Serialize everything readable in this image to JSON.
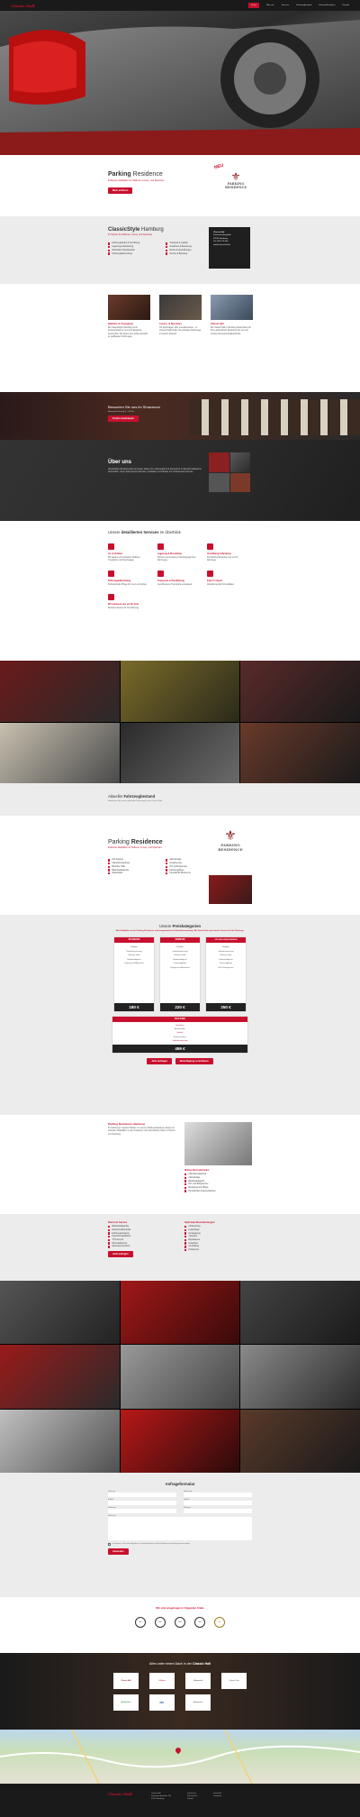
{
  "header": {
    "logo_text": "Classic Hall",
    "nav": [
      "Home",
      "Über uns",
      "Services",
      "Fahrzeugbestand",
      "Parking Residence",
      "Kontakt"
    ]
  },
  "residence_banner": {
    "title_bold": "Parking",
    "title_rest": " Residence",
    "subtitle": "Exklusive Stellplätze für Oldtimer, Luxury- und Sportcars",
    "button": "Mehr erfahren",
    "new_badge": "NEU",
    "logo_line1": "PARKING",
    "logo_line2": "RESIDENCE"
  },
  "classicstyle": {
    "title_bold": "ClassicStyle",
    "title_rest": " Hamburg",
    "subtitle": "Ihr Partner für Oldtimer, Luxury- und Sportcars",
    "bullets_left": [
      "Fahrzeughandel & Vermittlung",
      "Lagerung & Einstellung",
      "Werkstatt & Restauration",
      "Fahrzeugaufbereitung"
    ],
    "bullets_right": [
      "Transport & Logistik",
      "Gutachten & Bewertung",
      "Events & Ausstellungen",
      "Service & Beratung"
    ],
    "contact_box": [
      "Classic Hall",
      "Schnackenburgallee",
      "22525 Hamburg",
      "Tel: 040 123 456",
      "info@classichall.de"
    ]
  },
  "three_cols": [
    {
      "title": "Oldtimer & Youngtimer",
      "text": "Die ClassicStyle Hamburg ist Ihr Ansprechpartner rund um klassische Automobile. Wir bieten eine große Auswahl an gepflegten Fahrzeugen."
    },
    {
      "title": "Luxury- & Sportcars",
      "text": "Ob Sportwagen oder Luxuslimousine – in unserer Halle finden Sie exklusive Fahrzeuge in bestem Zustand."
    },
    {
      "title": "Classic Hall",
      "text": "Die Classic Hall in Hamburg bietet Raum für Ihre Leidenschaft. Besuchen Sie uns und erleben Sie Automobilgeschichte."
    }
  ],
  "visit": {
    "title": "Besuchen Sie uns im Showroom",
    "sub": "Montag bis Freitag 9 – 18 Uhr",
    "button": "Termin vereinbaren"
  },
  "about": {
    "title": "Über uns",
    "text": "ClassicStyle Hamburg steht seit vielen Jahren für Leidenschaft und Kompetenz im Bereich klassischer Automobile. Unser Team betreut Sammler, Liebhaber und Händler mit umfassendem Service."
  },
  "services": {
    "title_pre": "Unsere ",
    "title_bold": "detaillierten Services",
    "title_post": " im Überblick",
    "items": [
      {
        "title": "An- & Verkauf",
        "text": "Wir kaufen und verkaufen Oldtimer, Youngtimer und Sportwagen."
      },
      {
        "title": "Lagerung & Einstellung",
        "text": "Sichere und trockene Unterbringung Ihres Fahrzeugs."
      },
      {
        "title": "Vermittlung & Beratung",
        "text": "Persönliche Beratung rund um Ihr Fahrzeug."
      },
      {
        "title": "Fahrzeugaufbereitung",
        "text": "Professionelle Pflege für Innen und Außen."
      },
      {
        "title": "Transporte & Überführung",
        "text": "Geschlossene Transporte europaweit."
      },
      {
        "title": "Export / Import",
        "text": "Abwicklung aller Formalitäten."
      },
      {
        "title": "Wir kümmern uns um Ihr Auto",
        "text": "Rundum-Service für Ihr Fahrzeug."
      }
    ]
  },
  "stock": {
    "title_pre": "Aktueller ",
    "title_bold": "Fahrzeugbestand",
    "sub": "Entdecken Sie unsere aktuellen Fahrzeuge in der Classic Hall"
  },
  "residence2": {
    "title_pre": "Parking ",
    "title_bold": "Residence",
    "subtitle": "Exklusive Stellplätze für Oldtimer, Luxury- und Sportcars",
    "bullets_left": [
      "24h Zugang",
      "Videoüberwachung",
      "Beheizte Halle",
      "Batterieladegeräte",
      "Waschplatz"
    ],
    "bullets_right": [
      "Alarmanlage",
      "Versicherung",
      "Hol- & Bringservice",
      "Fahrzeugpflege",
      "Persönliche Betreuung"
    ]
  },
  "pricing": {
    "title_pre": "Unsere ",
    "title_bold": "Preiskategorien",
    "sub": "Alle Stellplätze in der Parking Residence sind ausgestattet mit Videoüberwachung. Wir bieten Ihnen den besten Service für Ihr Fahrzeug.",
    "plans": [
      {
        "name": "STANDARD",
        "features": [
          "Stellplatz",
          "Videoüberwachung",
          "Beheizte Halle",
          "Batterieladegerät",
          "Zugang nach Absprache"
        ],
        "price": "180 €"
      },
      {
        "name": "PREMIUM",
        "features": [
          "Stellplatz",
          "Videoüberwachung",
          "Beheizte Halle",
          "Batterieladegerät",
          "Fahrzeugpflege",
          "Zugang nach Absprache"
        ],
        "price": "220 €"
      },
      {
        "name": "VIP EXKLUSIVE PARKEN",
        "features": [
          "Stellplatz",
          "Videoüberwachung",
          "Beheizte Halle",
          "Batterieladegerät",
          "Fahrzeugpflege",
          "Hol- & Bringservice"
        ],
        "price": "250 €"
      }
    ],
    "extra": {
      "name": "BOX PARK",
      "lines": [
        "Einzelbox",
        "Abschließbar",
        "Beheizt",
        "Stromanschluss",
        "Videoüberwachung"
      ],
      "price": "499 €"
    },
    "btn1": "Jetzt anfragen",
    "btn2": "Besichtigung vereinbaren"
  },
  "residence_info": {
    "title": "Parking Residence Hamburg",
    "text": "Ihr Fahrzeug in besten Händen. In unserer Parking Residence bieten wir exklusive Stellplätze in einer beheizten und überwachten Halle im Herzen von Hamburg.",
    "list_title": "Weitere Besonderheiten",
    "list": [
      "Videoüberwachung",
      "Alarmanlage",
      "Batterieladegerät",
      "Hol- und Bringservice",
      "Reinigung und Pflege",
      "Persönlicher Ansprechpartner"
    ]
  },
  "wellness": {
    "left_title": "Rund um Service",
    "left": [
      "Batterieladegeräte",
      "Reifendruckkontrolle",
      "Fahrzeugreinigung",
      "Überführungsfahrten",
      "TÜV-Service",
      "Werkstattservice",
      "Saisonkennzeichen"
    ],
    "right_title": "Optionale Dienstleistungen",
    "right": [
      "Aufbereitung",
      "Lederpflege",
      "Versiegelung",
      "Transport",
      "Reparaturen",
      "Gutachten",
      "Vermittlung",
      "Fotoservice"
    ],
    "button": "Jetzt anfragen"
  },
  "form": {
    "title": "Anfrageformular",
    "labels": [
      "Vorname",
      "Nachname",
      "E-Mail",
      "Telefon",
      "Fahrzeug",
      "Zeitraum",
      "Nachricht"
    ],
    "privacy": "Ich stimme zu, dass meine Angaben zur Kontaktaufnahme und für Rückfragen dauerhaft gespeichert werden.",
    "submit": "Absenden"
  },
  "partners": {
    "title": "Wir sind eingetragen in folgenden Clubs",
    "logos": [
      "Club 1",
      "Club 2",
      "Club 3",
      "Club 4",
      "Club 5"
    ]
  },
  "under_roof": {
    "title_pre": "Alles unter einem Dach in der ",
    "title_bold": "Classic Hall",
    "logos": [
      "Classic Hall",
      "Oldtimer",
      "Motorworld",
      "Classic Cars",
      "NordicCars",
      "MPL",
      "Automotive"
    ]
  },
  "footer": {
    "logo_text": "Classic Hall",
    "col1": [
      "Classic Hall",
      "Schnackenburgallee 150",
      "22525 Hamburg"
    ],
    "col2": [
      "Impressum",
      "Datenschutz",
      "Kontakt"
    ],
    "col3": [
      "Facebook",
      "Instagram"
    ]
  },
  "colors": {
    "accent": "#c8102e",
    "dark": "#222222",
    "light": "#ececec"
  }
}
